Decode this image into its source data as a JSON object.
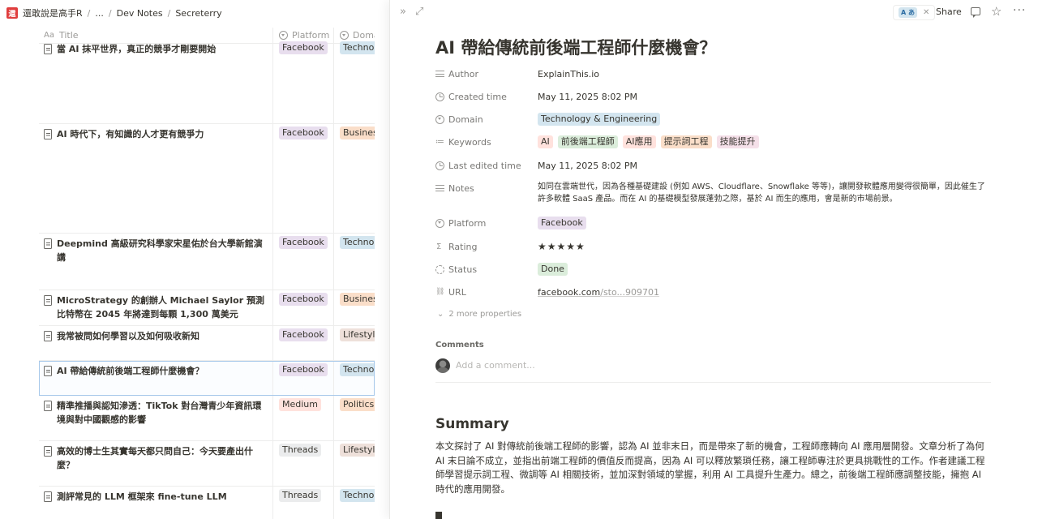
{
  "breadcrumb": {
    "workspace_icon": "還",
    "workspace": "還敢說是高手R",
    "ellipsis": "...",
    "items": [
      "Dev Notes",
      "Secreterry"
    ]
  },
  "table": {
    "columns": {
      "title_icon": "Aa",
      "title": "Title",
      "platform": "Platform",
      "domain": "Domain"
    },
    "rows": [
      {
        "title": "當 AI 抹平世界，真正的競爭才剛要開始",
        "platform": "Facebook",
        "domain": "Technology & Engineering"
      },
      {
        "title": "AI 時代下，有知識的人才更有競爭力",
        "platform": "Facebook",
        "domain": "Business"
      },
      {
        "title": "Deepmind 高級研究科學家宋星佑於台大學新館演講",
        "platform": "Facebook",
        "domain": "Technology & Engineering"
      },
      {
        "title": "MicroStrategy 的創辦人 Michael Saylor 預測比特幣在 2045 年將達到每顆 1,300 萬美元",
        "platform": "Facebook",
        "domain": "Business"
      },
      {
        "title": "我常被問如何學習以及如何吸收新知",
        "platform": "Facebook",
        "domain": "Lifestyle"
      },
      {
        "title": "AI 帶給傳統前後端工程師什麼機會？",
        "platform": "Facebook",
        "domain": "Technology & Engineering"
      },
      {
        "title": "精準推播與認知滲透：TikTok 對台灣青少年資訊環境與對中國觀感的影響",
        "platform": "Medium",
        "domain": "Politics & Society"
      },
      {
        "title": "高效的博士生其實每天都只問自己：今天要產出什麼？",
        "platform": "Threads",
        "domain": "Lifestyle"
      },
      {
        "title": "測評常見的 LLM 框架來 fine-tune LLM",
        "platform": "Threads",
        "domain": "Technology & Engineering"
      }
    ]
  },
  "peek": {
    "translate_badge": "A あ",
    "share": "Share",
    "title": "AI 帶給傳統前後端工程師什麼機會？",
    "props": {
      "author_label": "Author",
      "author": "ExplainThis.io",
      "created_label": "Created time",
      "created": "May 11, 2025 8:02 PM",
      "domain_label": "Domain",
      "domain": "Technology & Engineering",
      "keywords_label": "Keywords",
      "keywords": [
        "AI",
        "前後端工程師",
        "AI應用",
        "提示詞工程",
        "技能提升"
      ],
      "edited_label": "Last edited time",
      "edited": "May 11, 2025 8:02 PM",
      "notes_label": "Notes",
      "notes": "如同在雲端世代，因為各種基礎建設 (例如 AWS、Cloudflare、Snowflake 等等)，讓開發軟體應用變得很簡單，因此催生了許多軟體 SaaS 產品。而在 AI 的基礎模型發展蓬勃之際，基於 AI 而生的應用，會是新的市場前景。",
      "platform_label": "Platform",
      "platform": "Facebook",
      "rating_label": "Rating",
      "rating": "★★★★★",
      "status_label": "Status",
      "status": "Done",
      "url_label": "URL",
      "url_main": "facebook.com",
      "url_rest": "/sto...909701"
    },
    "more_props": "2 more properties",
    "comments_title": "Comments",
    "comment_placeholder": "Add a comment...",
    "summary_heading": "Summary",
    "summary_text": "本文探討了 AI 對傳統前後端工程師的影響，認為 AI 並非末日，而是帶來了新的機會，工程師應轉向 AI 應用層開發。文章分析了為何 AI 末日論不成立，並指出前端工程師的價值反而提高，因為 AI 可以釋放繁瑣任務，讓工程師專注於更具挑戰性的工作。作者建議工程師學習提示詞工程、微調等 AI 相關技術，並加深對領域的掌握，利用 AI 工具提升生產力。總之，前後端工程師應調整技能，擁抱 AI 時代的應用開發。"
  },
  "colors": {
    "accent_selected_outline": "#a6c8ea",
    "tag_purple": "#e8deee",
    "tag_blue": "#d3e5ef",
    "tag_orange": "#fadec9",
    "status_done": "#dbeddb"
  }
}
